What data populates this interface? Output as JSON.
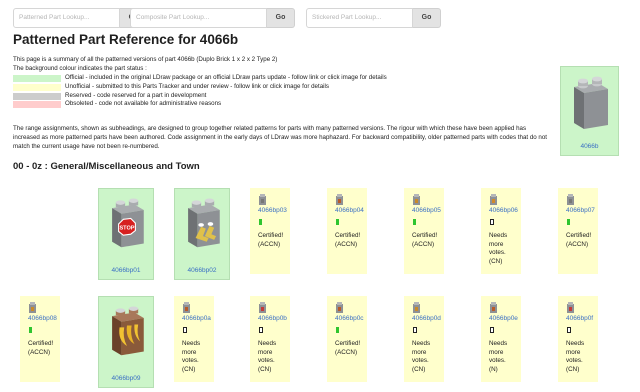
{
  "search": {
    "pattern_placeholder": "Patterned Part Lookup...",
    "composite_placeholder": "Composite Part Lookup...",
    "stickered_placeholder": "Stickered Part Lookup...",
    "go_label": "Go"
  },
  "page_title": "Patterned Part Reference for 4066b",
  "description": {
    "intro": "This page is a summary of all the patterned versions of part 4066b (Duplo Brick 1 x 2 x 2 Type 2)",
    "legend_intro": "The background colour indicates the part status :",
    "statuses": [
      {
        "color": "#ccf5c9",
        "text": "Official - included in the original LDraw package or an official LDraw parts update - follow link or click image for details"
      },
      {
        "color": "#ffffcc",
        "text": "Unofficial - submitted to this Parts Tracker and under review - follow link or click image for details"
      },
      {
        "color": "#cccccc",
        "text": "Reserved - code reserved for a part in development"
      },
      {
        "color": "#ffcccc",
        "text": "Obsoleted - code not available for administrative reasons"
      }
    ],
    "range_text": "The range assignments, shown as subheadings, are designed to group together related patterns for parts with many patterned versions. The rigour with which these have been applied has increased as more patterned parts have been authored. Code assignment in the early days of LDraw was more haphazard. For backward compatibility, older patterned parts with codes that do not match the current usage have not been re-numbered."
  },
  "main_part": {
    "label": "4066b"
  },
  "section_heading": "00 - 0z : General/Miscellaneous and Town",
  "tiles": [
    {
      "id": "4066bp01",
      "status": "official",
      "image": "stop-sign"
    },
    {
      "id": "4066bp02",
      "status": "official",
      "image": "boots"
    },
    {
      "id": "4066bp03",
      "status": "unofficial",
      "text": [
        "Certified!",
        "(ACCN)"
      ]
    },
    {
      "id": "4066bp04",
      "status": "unofficial",
      "text": [
        "Certified!",
        "(ACCN)"
      ]
    },
    {
      "id": "4066bp05",
      "status": "unofficial",
      "text": [
        "Certified!",
        "(ACCN)"
      ]
    },
    {
      "id": "4066bp06",
      "status": "unofficial",
      "text": [
        "Needs",
        "more",
        "votes.",
        "(CN)"
      ]
    },
    {
      "id": "4066bp07",
      "status": "unofficial",
      "text": [
        "Certified!",
        "(ACCN)"
      ]
    },
    {
      "id": "4066bp08",
      "status": "unofficial",
      "text": [
        "Certified!",
        "(ACCN)"
      ]
    },
    {
      "id": "4066bp09",
      "status": "official",
      "image": "bananas"
    },
    {
      "id": "4066bp0a",
      "status": "unofficial",
      "text": [
        "Needs",
        "more",
        "votes.",
        "(CN)"
      ]
    },
    {
      "id": "4066bp0b",
      "status": "unofficial",
      "text": [
        "Needs",
        "more",
        "votes.",
        "(CN)"
      ]
    },
    {
      "id": "4066bp0c",
      "status": "unofficial",
      "text": [
        "Certified!",
        "(ACCN)"
      ]
    },
    {
      "id": "4066bp0d",
      "status": "unofficial",
      "text": [
        "Needs",
        "more",
        "votes.",
        "(CN)"
      ]
    },
    {
      "id": "4066bp0e",
      "status": "unofficial",
      "text": [
        "Needs",
        "more",
        "votes.",
        "(N)"
      ]
    },
    {
      "id": "4066bp0f",
      "status": "unofficial",
      "text": [
        "Needs",
        "more",
        "votes.",
        "(CN)"
      ]
    }
  ]
}
